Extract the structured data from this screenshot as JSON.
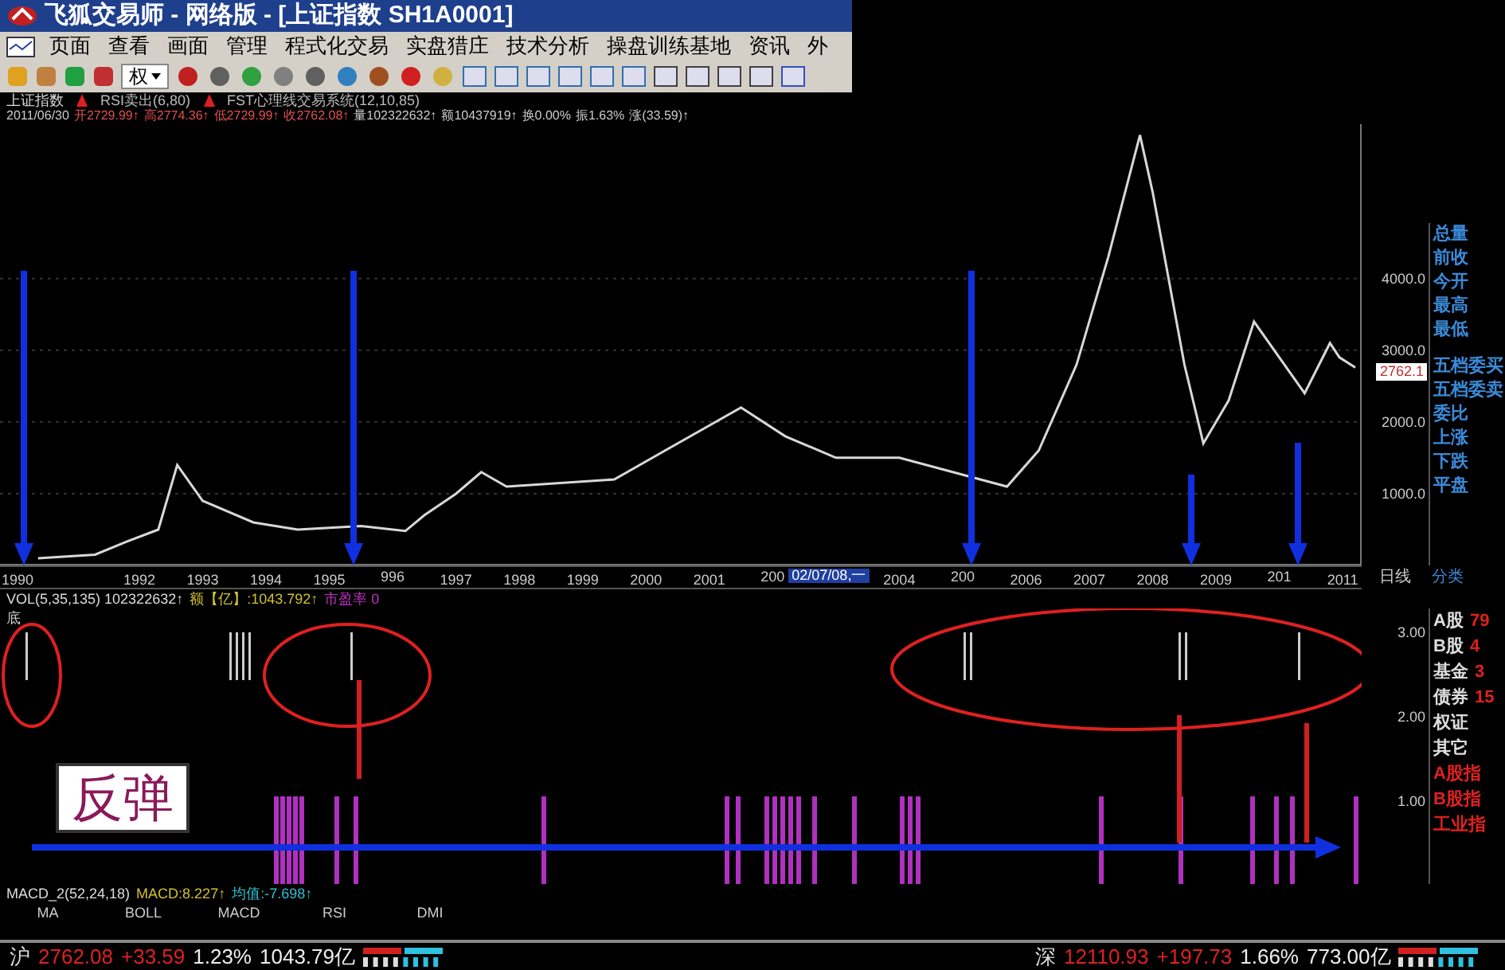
{
  "window": {
    "title": "飞狐交易师 - 网络版 - [上证指数 SH1A0001]"
  },
  "menu": [
    "页面",
    "查看",
    "画面",
    "管理",
    "程式化交易",
    "实盘猎庄",
    "技术分析",
    "操盘训练基地",
    "资讯",
    "外"
  ],
  "toolbar": {
    "rights_label": "权"
  },
  "indicator_line": [
    "上证指数",
    "RSI卖出(6,80)",
    "FST心理线交易系统(12,10,85)"
  ],
  "quote_line": [
    "2011/06/30",
    "开2729.99↑",
    "高2774.36↑",
    "低2729.99↑",
    "收2762.08↑",
    "量102322632↑",
    "额10437919↑",
    "换0.00%",
    "振1.63%",
    "涨(33.59)↑"
  ],
  "chart_data": {
    "type": "line",
    "grid": true,
    "x": [
      1990.4,
      1991.3,
      1991.8,
      1992.3,
      1992.6,
      1993.0,
      1993.8,
      1994.5,
      1995.5,
      1996.2,
      1996.5,
      1997.0,
      1997.4,
      1997.8,
      1999.5,
      2000.3,
      2001.5,
      2002.2,
      2003.0,
      2004.0,
      2005.7,
      2006.2,
      2006.8,
      2007.3,
      2007.8,
      2008.0,
      2008.5,
      2008.8,
      2009.2,
      2009.6,
      2010.0,
      2010.4,
      2010.8,
      2010.95,
      2011.2
    ],
    "series": [
      {
        "color": "#d8d8d8",
        "values": [
          100,
          150,
          330,
          500,
          1400,
          900,
          600,
          500,
          550,
          480,
          700,
          1000,
          1300,
          1100,
          1200,
          1600,
          2200,
          1800,
          1500,
          1500,
          1100,
          1600,
          2800,
          4300,
          6000,
          5200,
          2800,
          1700,
          2300,
          3400,
          2900,
          2400,
          3100,
          2900,
          2760
        ]
      }
    ],
    "xlim": [
      1989.8,
      2011.3
    ],
    "ylim": [
      0,
      6150
    ],
    "xticks": [
      1990,
      1992,
      1993,
      1994,
      1995,
      1997,
      1998,
      1999,
      2000,
      2001,
      2004,
      2006,
      2007,
      2008,
      2009,
      2011
    ],
    "yticks": [
      {
        "value": 4000,
        "label": "4000.0"
      },
      {
        "value": 3000,
        "label": "3000.0"
      },
      {
        "value": 2000,
        "label": "2000.0"
      },
      {
        "value": 1000,
        "label": "1000.0"
      }
    ]
  },
  "price_tag": "2762.1",
  "cut_year_labels": [
    "996",
    "200",
    "200",
    "201"
  ],
  "cursor_date": "02/07/08,一",
  "period_label": "日线",
  "quote_panel": [
    "总量",
    "前收",
    "今开",
    "最高",
    "最低",
    "五档委买",
    "五档委卖",
    "委比",
    "上涨",
    "下跌",
    "平盘"
  ],
  "category_tab": "分类",
  "volume_line": {
    "params": "VOL(5,35,135) 102322632↑",
    "amount": "额【亿】:1043.792↑",
    "pe": "市盈率 0"
  },
  "lower_label": "底",
  "lower_axis": [
    "3.00",
    "2.00",
    "1.00"
  ],
  "annotation": "反弹",
  "market_list": [
    {
      "label": "A股",
      "value": "79",
      "kind": "stock"
    },
    {
      "label": "B股",
      "value": "4",
      "kind": "stock"
    },
    {
      "label": "基金",
      "value": "3",
      "kind": "stock"
    },
    {
      "label": "债券",
      "value": "15",
      "kind": "stock"
    },
    {
      "label": "权证",
      "kind": "stock"
    },
    {
      "label": "其它",
      "kind": "stock"
    },
    {
      "label": "A股指",
      "kind": "index"
    },
    {
      "label": "B股指",
      "kind": "index"
    },
    {
      "label": "工业指",
      "kind": "index"
    }
  ],
  "macd_line": {
    "params": "MACD_2(52,24,18)",
    "macd": "MACD:8.227↑",
    "mean": "均值:-7.698↑"
  },
  "indicator_tabs": [
    "MA",
    "BOLL",
    "MACD",
    "RSI",
    "DMI"
  ],
  "status_bar": [
    {
      "market": "沪",
      "price": "2762.08",
      "change": "+33.59",
      "percent": "1.23%",
      "amount": "1043.79亿"
    },
    {
      "market": "深",
      "price": "12110.93",
      "change": "+197.73",
      "percent": "1.66%",
      "amount": "773.00亿"
    }
  ]
}
